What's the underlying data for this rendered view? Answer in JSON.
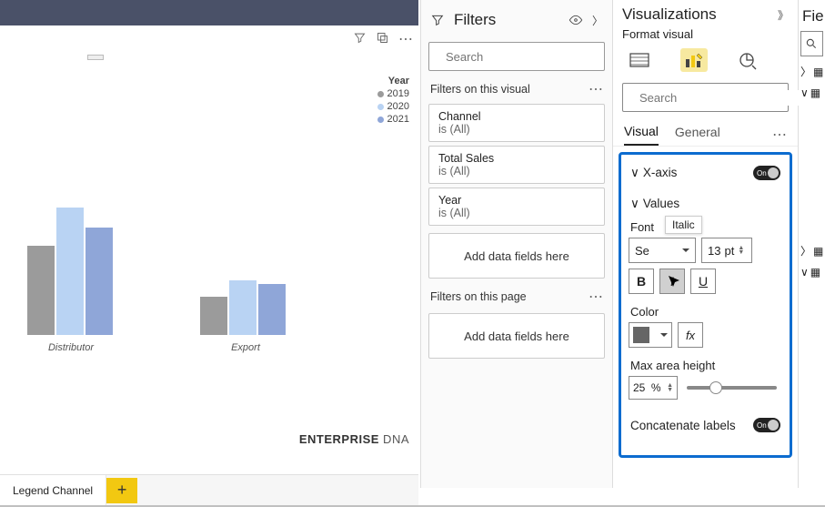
{
  "chart_data": {
    "type": "bar",
    "categories": [
      "Distributor",
      "Export"
    ],
    "series": [
      {
        "name": "2019",
        "color": "#9b9b9b",
        "values": [
          98,
          42
        ]
      },
      {
        "name": "2020",
        "color": "#b9d3f3",
        "values": [
          140,
          60
        ]
      },
      {
        "name": "2021",
        "color": "#8fa6d8",
        "values": [
          118,
          56
        ]
      }
    ],
    "title": "",
    "xlabel": "",
    "ylabel": "",
    "legend_title": "Year"
  },
  "watermark_a": "ENTERPRISE",
  "watermark_b": " DNA",
  "tabs": {
    "active": "Legend Channel"
  },
  "filters": {
    "title": "Filters",
    "search_placeholder": "Search",
    "section_visual": "Filters on this visual",
    "cards": [
      {
        "title": "Channel",
        "sub": "is (All)"
      },
      {
        "title": "Total Sales",
        "sub": "is (All)"
      },
      {
        "title": "Year",
        "sub": "is (All)"
      }
    ],
    "drop1": "Add data fields here",
    "section_page": "Filters on this page",
    "drop2": "Add data fields here"
  },
  "viz": {
    "title": "Visualizations",
    "subtitle": "Format visual",
    "search_placeholder": "Search",
    "tab_visual": "Visual",
    "tab_general": "General",
    "xaxis": "X-axis",
    "xaxis_toggle": "On",
    "values": "Values",
    "font_label": "Font",
    "font_family": "Se",
    "font_size": "13",
    "font_unit": "pt",
    "tooltip": "Italic",
    "bold": "B",
    "italic": "I",
    "underline": "U",
    "color_label": "Color",
    "fx": "fx",
    "max_label": "Max area height",
    "pct_value": "25",
    "pct_unit": "%",
    "concat_label": "Concatenate labels",
    "concat_toggle": "On"
  },
  "fields": {
    "title": "Fie"
  }
}
